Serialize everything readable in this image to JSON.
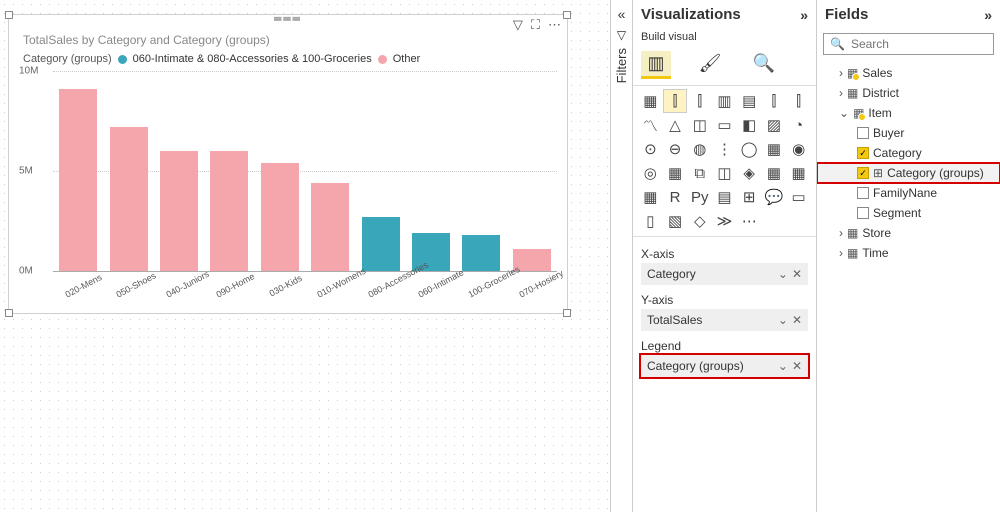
{
  "chart_data": {
    "type": "bar",
    "title": "TotalSales by Category and Category (groups)",
    "legend_title": "Category (groups)",
    "series_labels": [
      "060-Intimate & 080-Accessories & 100-Groceries",
      "Other"
    ],
    "colors": {
      "group": "#3aa6b9",
      "other": "#f4a6ac"
    },
    "xlabel": "",
    "ylabel": "",
    "yticks": [
      {
        "v": 0,
        "l": "0M"
      },
      {
        "v": 5,
        "l": "5M"
      },
      {
        "v": 10,
        "l": "10M"
      }
    ],
    "ylim": [
      0,
      10
    ],
    "categories": [
      {
        "name": "020-Mens",
        "value": 9.1,
        "series": "other"
      },
      {
        "name": "050-Shoes",
        "value": 7.2,
        "series": "other"
      },
      {
        "name": "040-Juniors",
        "value": 6.0,
        "series": "other"
      },
      {
        "name": "090-Home",
        "value": 6.0,
        "series": "other"
      },
      {
        "name": "030-Kids",
        "value": 5.4,
        "series": "other"
      },
      {
        "name": "010-Womens",
        "value": 4.4,
        "series": "other"
      },
      {
        "name": "080-Accessories",
        "value": 2.7,
        "series": "group"
      },
      {
        "name": "060-Intimate",
        "value": 1.9,
        "series": "group"
      },
      {
        "name": "100-Groceries",
        "value": 1.8,
        "series": "group"
      },
      {
        "name": "070-Hosiery",
        "value": 1.1,
        "series": "other"
      }
    ]
  },
  "filters_rail": {
    "label": "Filters"
  },
  "viz_panel": {
    "title": "Visualizations",
    "subtitle": "Build visual",
    "wells": {
      "x": {
        "label": "X-axis",
        "value": "Category"
      },
      "y": {
        "label": "Y-axis",
        "value": "TotalSales"
      },
      "legend": {
        "label": "Legend",
        "value": "Category (groups)"
      }
    }
  },
  "fields_panel": {
    "title": "Fields",
    "search_placeholder": "Search",
    "tables": [
      {
        "name": "Sales",
        "icon": "table-y",
        "expanded": false
      },
      {
        "name": "District",
        "icon": "table",
        "expanded": false
      },
      {
        "name": "Item",
        "icon": "table-y",
        "expanded": true,
        "fields": [
          {
            "name": "Buyer",
            "checked": false
          },
          {
            "name": "Category",
            "checked": true
          },
          {
            "name": "Category (groups)",
            "checked": true,
            "highlight": true,
            "group": true
          },
          {
            "name": "FamilyNane",
            "checked": false
          },
          {
            "name": "Segment",
            "checked": false
          }
        ]
      },
      {
        "name": "Store",
        "icon": "table",
        "expanded": false
      },
      {
        "name": "Time",
        "icon": "table",
        "expanded": false
      }
    ]
  }
}
